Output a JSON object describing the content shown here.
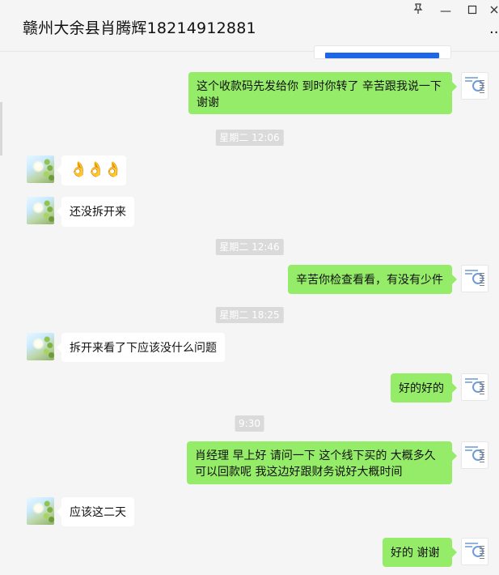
{
  "window": {
    "title": "赣州大余县肖腾辉18214912881",
    "pin_icon": "pin-icon",
    "minimize_icon": "minimize-icon",
    "maximize_icon": "maximize-icon",
    "close_icon": "close-icon",
    "more_icon": "more-icon"
  },
  "colors": {
    "sent_bubble": "#95ec69",
    "received_bubble": "#ffffff",
    "timestamp_bg": "#dadada",
    "link_bar": "#1e66e8"
  },
  "avatars": {
    "contact": "contact-avatar",
    "self": "self-avatar"
  },
  "messages": [
    {
      "sender": "self",
      "text": "  这个收款码先发给你   到时你转了  辛苦跟我说一下 谢谢"
    },
    {
      "type": "time",
      "text": "星期二 12:06"
    },
    {
      "sender": "contact",
      "text": "👌👌👌"
    },
    {
      "sender": "contact",
      "text": "还没拆开来"
    },
    {
      "type": "time",
      "text": "星期二 12:46"
    },
    {
      "sender": "self",
      "text": "辛苦你检查看看，有没有少件"
    },
    {
      "type": "time",
      "text": "星期二 18:25"
    },
    {
      "sender": "contact",
      "text": "拆开来看了下应该没什么问题"
    },
    {
      "sender": "self",
      "text": "好的好的"
    },
    {
      "type": "time",
      "text": "9:30"
    },
    {
      "sender": "self",
      "text": "肖经理  早上好   请问一下 这个线下买的    大概多久可以回款呢  我这边好跟财务说好大概时间"
    },
    {
      "sender": "contact",
      "text": "应该这二天"
    },
    {
      "sender": "self",
      "text": "好的  谢谢"
    }
  ]
}
